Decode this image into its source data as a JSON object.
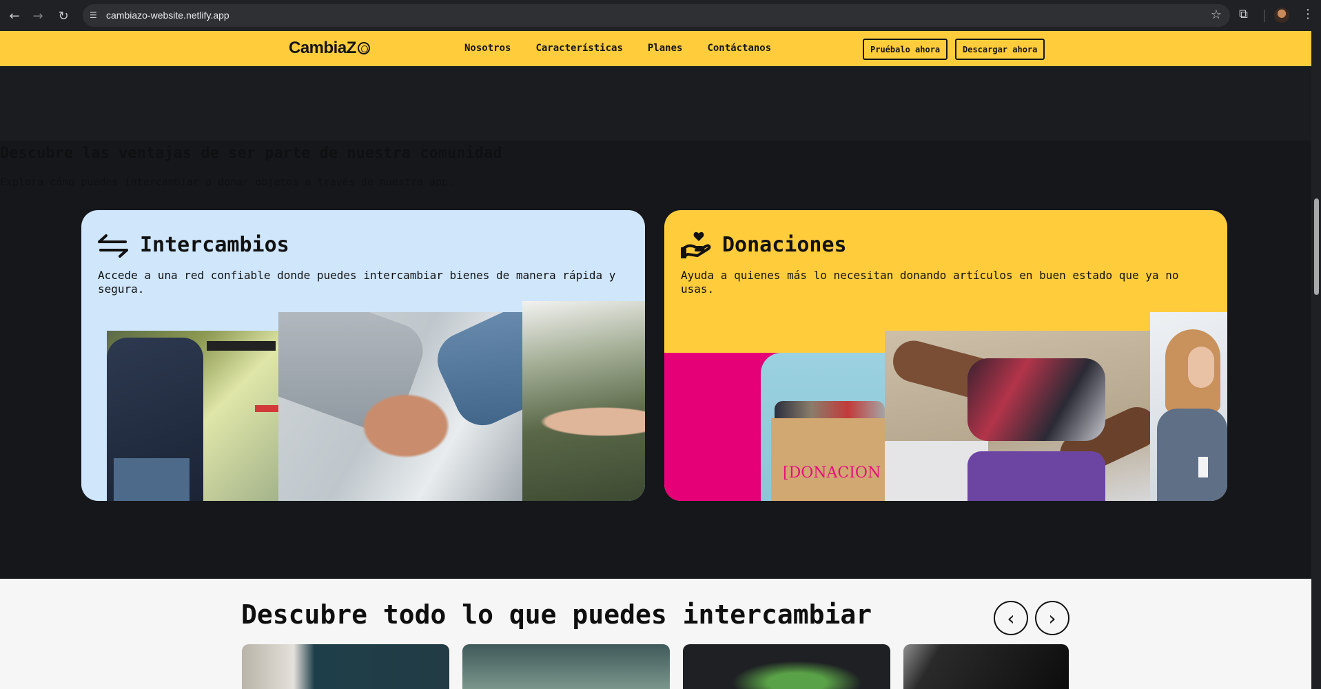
{
  "browser": {
    "url": "cambiazo-website.netlify.app",
    "back_icon": "arrow-left-icon",
    "forward_icon": "arrow-right-icon",
    "reload_icon": "reload-icon",
    "site_info_icon": "tune-icon",
    "bookmark_icon": "star-icon",
    "extensions_icon": "puzzle-icon",
    "menu_icon": "kebab-icon"
  },
  "header": {
    "logo": "CambiaZ",
    "nav": [
      "Nosotros",
      "Características",
      "Planes",
      "Contáctanos"
    ],
    "try_button": "Pruébalo ahora",
    "download_button": "Descargar ahora",
    "bg_color": "#ffcd3c"
  },
  "intro": {
    "title": "Descubre las ventajas de ser parte de nuestra comunidad",
    "subtitle": "Explora cómo puedes intercambiar o donar objetos a través de nuestra app."
  },
  "cards": [
    {
      "title": "Intercambios",
      "icon": "swap-arrows-icon",
      "description": "Accede a una red confiable donde puedes intercambiar bienes de manera rápida y segura.",
      "bg_color": "#cfe6fb"
    },
    {
      "title": "Donaciones",
      "icon": "hand-heart-icon",
      "description": "Ayuda a quienes más lo necesitan donando artículos en buen estado que ya no usas.",
      "bg_color": "#ffcd3c",
      "photo_label": "[DONACION"
    }
  ],
  "exchange_section": {
    "title": "Descubre todo lo que puedes intercambiar",
    "prev_label": "‹",
    "next_label": "›"
  }
}
